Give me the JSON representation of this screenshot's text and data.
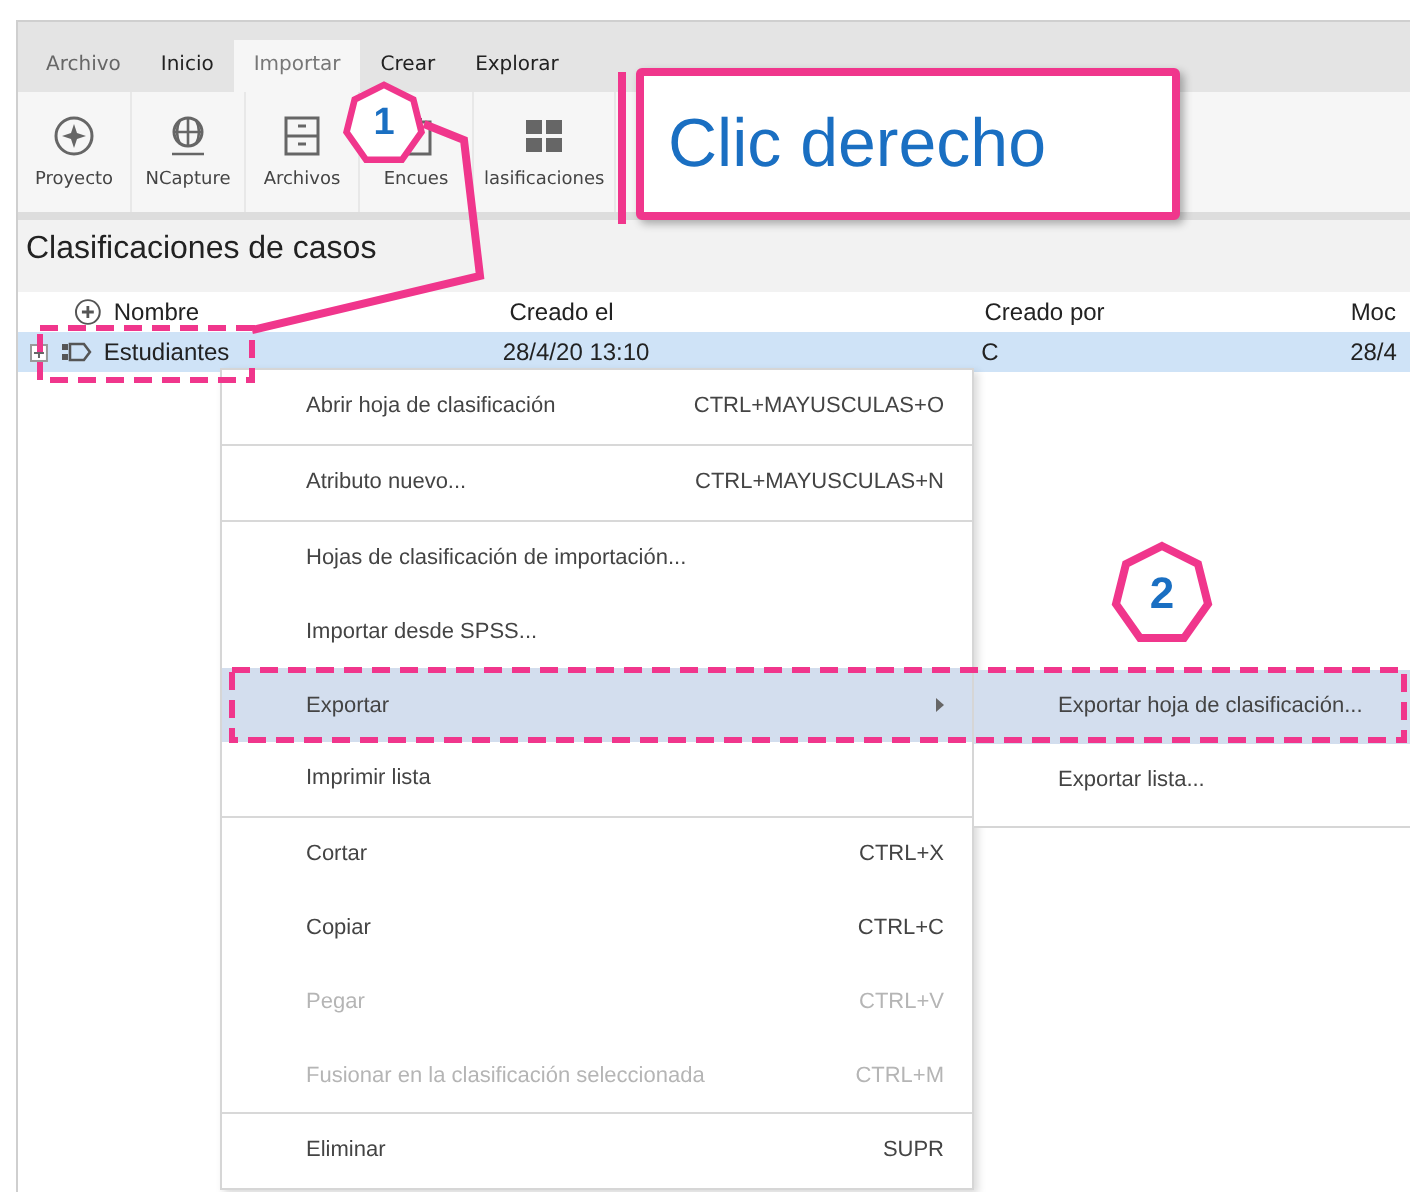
{
  "ribbon_tabs": [
    {
      "label": "Archivo",
      "selected": false
    },
    {
      "label": "Inicio",
      "selected": false
    },
    {
      "label": "Importar",
      "selected": true
    },
    {
      "label": "Crear",
      "selected": false
    },
    {
      "label": "Explorar",
      "selected": false
    }
  ],
  "ribbon_buttons": [
    {
      "label": "Proyecto",
      "kind": "project"
    },
    {
      "label": "NCapture",
      "kind": "globe"
    },
    {
      "label": "Archivos",
      "kind": "cabinet"
    },
    {
      "label": "Encues",
      "kind": "clipboard"
    },
    {
      "label": "lasificaciones",
      "kind": "grid"
    }
  ],
  "panel_title": "Clasificaciones de casos",
  "table": {
    "columns": [
      "Nombre",
      "Creado el",
      "Creado por",
      "Moc"
    ],
    "rows": [
      {
        "cells": [
          "Estudiantes",
          "28/4/20 13:10",
          "C",
          "28/4"
        ],
        "selected": true
      }
    ]
  },
  "context_menu": [
    {
      "kind": "item",
      "label": "Abrir hoja de clasificación",
      "shortcut": "CTRL+MAYUSCULAS+O",
      "disabled": false,
      "selected": false
    },
    {
      "kind": "separator"
    },
    {
      "kind": "item",
      "label": "Atributo nuevo...",
      "shortcut": "CTRL+MAYUSCULAS+N",
      "disabled": false,
      "selected": false
    },
    {
      "kind": "separator"
    },
    {
      "kind": "item",
      "label": "Hojas de clasificación de importación...",
      "disabled": false,
      "selected": false
    },
    {
      "kind": "item",
      "label": "Importar desde SPSS...",
      "disabled": false,
      "selected": false
    },
    {
      "kind": "submenu",
      "label": "Exportar",
      "disabled": false,
      "selected": true
    },
    {
      "kind": "item",
      "label": "Imprimir lista",
      "disabled": false,
      "selected": false
    },
    {
      "kind": "separator"
    },
    {
      "kind": "item",
      "label": "Cortar",
      "shortcut": "CTRL+X",
      "disabled": false,
      "selected": false
    },
    {
      "kind": "item",
      "label": "Copiar",
      "shortcut": "CTRL+C",
      "disabled": false,
      "selected": false
    },
    {
      "kind": "item",
      "label": "Pegar",
      "shortcut": "CTRL+V",
      "disabled": true,
      "selected": false
    },
    {
      "kind": "item",
      "label": "Fusionar en la clasificación seleccionada",
      "shortcut": "CTRL+M",
      "disabled": true,
      "selected": false
    },
    {
      "kind": "separator"
    },
    {
      "kind": "item",
      "label": "Eliminar",
      "shortcut": "SUPR",
      "disabled": false,
      "selected": false
    }
  ],
  "submenu": [
    {
      "label": "Exportar hoja de clasificación...",
      "selected": true
    },
    {
      "label": "Exportar lista...",
      "selected": false
    }
  ],
  "annotations": {
    "callout": "Clic derecho",
    "steps": [
      "1",
      "2"
    ]
  }
}
